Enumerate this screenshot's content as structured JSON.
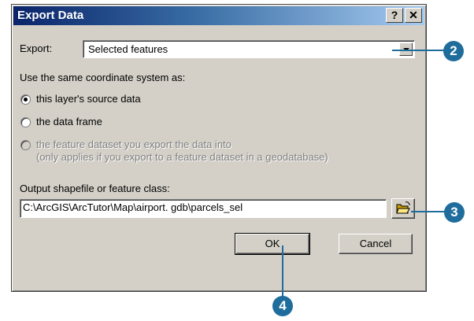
{
  "dialog": {
    "title": "Export Data",
    "help_label": "?",
    "close_label": "✕"
  },
  "export": {
    "label": "Export:",
    "selected": "Selected features"
  },
  "coordinate": {
    "label": "Use the same coordinate system as:",
    "options": [
      {
        "label": "this layer's source data",
        "checked": true,
        "enabled": true
      },
      {
        "label": "the data frame",
        "checked": false,
        "enabled": true
      },
      {
        "label": "the feature dataset you export the data into",
        "sublabel": "(only applies if you export to a feature dataset in a geodatabase)",
        "checked": false,
        "enabled": false
      }
    ]
  },
  "output": {
    "label": "Output shapefile or feature class:",
    "value": "C:\\ArcGIS\\ArcTutor\\Map\\airport. gdb\\parcels_sel",
    "browse_icon": "folder-open-icon"
  },
  "buttons": {
    "ok": "OK",
    "cancel": "Cancel"
  },
  "callouts": [
    "2",
    "3",
    "4"
  ],
  "colors": {
    "callout": "#1f6d9c",
    "titlebar_start": "#0a246a",
    "dialog_face": "#d4d0c8"
  }
}
